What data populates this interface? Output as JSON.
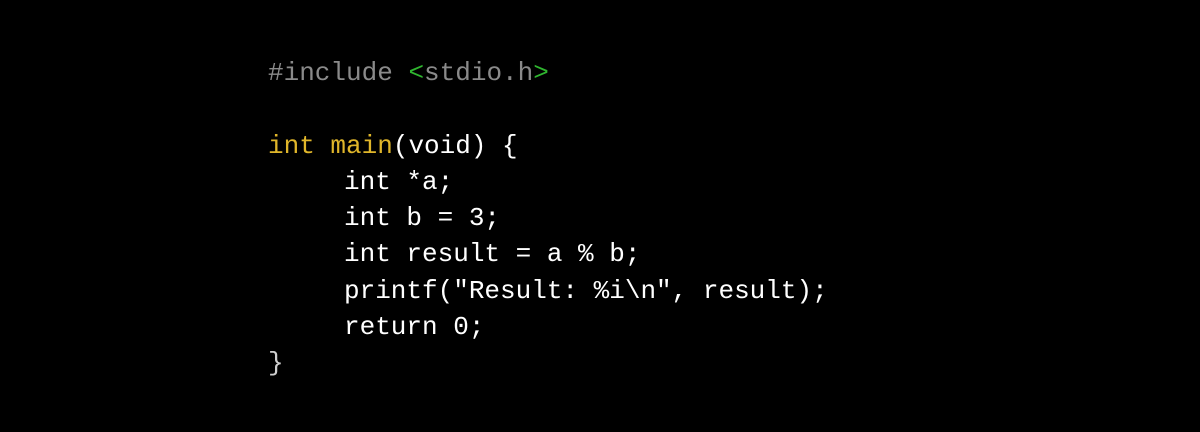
{
  "colors": {
    "background": "#000000",
    "text": "#ffffff",
    "directive": "#8a8a8a",
    "header_bracket": "#2fb52f",
    "keyword_accent": "#e0b62a"
  },
  "code": {
    "line1": {
      "directive": "#include ",
      "bracket_open": "<",
      "header": "stdio.h",
      "bracket_close": ">"
    },
    "line3": {
      "type": "int",
      "func": "main",
      "rest": "(void) {"
    },
    "line4": "int *a;",
    "line5": "int b = 3;",
    "line6": "int result = a % b;",
    "line7": "printf(\"Result: %i\\n\", result);",
    "line8": "return 0;",
    "line9": "}"
  }
}
